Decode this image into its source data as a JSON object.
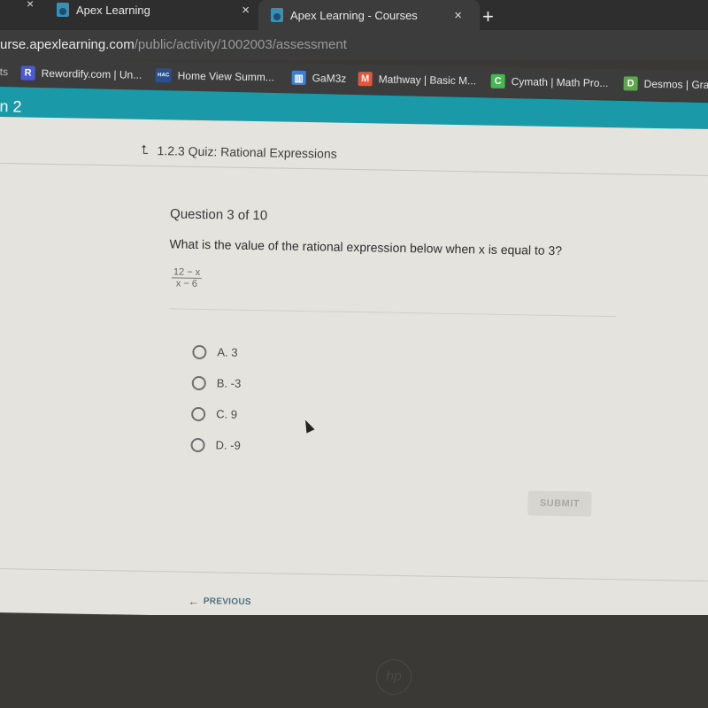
{
  "browser": {
    "tabs": [
      {
        "title": "Apex Learning",
        "active": false
      },
      {
        "title": "Apex Learning - Courses",
        "active": true
      }
    ],
    "close_glyph": "×",
    "new_tab_glyph": "+",
    "url": {
      "host": "urse.apexlearning.com",
      "path": "/public/activity/1002003/assessment"
    },
    "bookmarks": [
      {
        "label": "Rewordify.com | Un...",
        "icon": "R",
        "color": "#4a5bd4"
      },
      {
        "label": "Home View Summ...",
        "icon": "HAC",
        "color": "#2b4f8a"
      },
      {
        "label": "GaM3z",
        "icon": "▥",
        "color": "#3e7fd1"
      },
      {
        "label": "Mathway | Basic M...",
        "icon": "M",
        "color": "#e2573b"
      },
      {
        "label": "Cymath | Math Pro...",
        "icon": "C",
        "color": "#46b84f"
      },
      {
        "label": "Desmos | Gra",
        "icon": "D",
        "color": "#5aa84a"
      }
    ],
    "bookmarks_prefix": "ts"
  },
  "course_header": {
    "text": "n 2",
    "color": "#1a9aa8"
  },
  "quiz": {
    "breadcrumb_icon": "⮤",
    "title": "1.2.3 Quiz: Rational Expressions",
    "question_number": "Question 3 of 10",
    "question_text": "What is the value of the rational expression below when x is equal to 3?",
    "expression": {
      "numerator": "12 − x",
      "denominator": "x − 6"
    },
    "options": [
      {
        "letter": "A.",
        "value": "3"
      },
      {
        "letter": "B.",
        "value": "-3"
      },
      {
        "letter": "C.",
        "value": "9"
      },
      {
        "letter": "D.",
        "value": "-9"
      }
    ],
    "submit_label": "SUBMIT",
    "previous_label": "PREVIOUS",
    "previous_arrow": "←"
  },
  "device": {
    "logo": "hp"
  }
}
